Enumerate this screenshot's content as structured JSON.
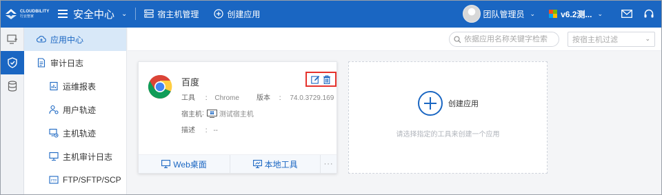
{
  "brand": {
    "logo_en": "CLOUDBILITY",
    "logo_cn": "行云管家"
  },
  "header": {
    "title": "安全中心",
    "nav": [
      {
        "label": "宿主机管理",
        "icon": "host-icon"
      },
      {
        "label": "创建应用",
        "icon": "plus-circle-icon"
      }
    ],
    "user": "团队管理员",
    "version": "v6.2测...",
    "icons": [
      "mail-icon",
      "headset-icon"
    ]
  },
  "rail": {
    "items": [
      {
        "icon": "console-icon",
        "active": false
      },
      {
        "icon": "shield-icon",
        "active": true
      },
      {
        "icon": "database-icon",
        "active": false
      }
    ]
  },
  "sidebar": {
    "items": [
      {
        "label": "应用中心",
        "icon": "cloud-app-icon",
        "level": 1,
        "active": true
      },
      {
        "label": "审计日志",
        "icon": "document-icon",
        "level": 1,
        "active": false
      },
      {
        "label": "运维报表",
        "icon": "report-icon",
        "level": 2,
        "active": false
      },
      {
        "label": "用户轨迹",
        "icon": "user-track-icon",
        "level": 2,
        "active": false
      },
      {
        "label": "主机轨迹",
        "icon": "host-track-icon",
        "level": 2,
        "active": false
      },
      {
        "label": "主机审计日志",
        "icon": "monitor-icon",
        "level": 2,
        "active": false
      },
      {
        "label": "FTP/SFTP/SCP",
        "icon": "ftp-icon",
        "level": 2,
        "active": false
      }
    ]
  },
  "toolbar": {
    "search_placeholder": "依据应用名称关键字检索",
    "host_filter_placeholder": "按宿主机过滤"
  },
  "app_card": {
    "name": "百度",
    "tool_label": "工具",
    "tool_value": "Chrome",
    "version_label": "版本",
    "version_value": "74.0.3729.169",
    "host_label": "宿主机",
    "host_value": "测试宿主机",
    "desc_label": "描述",
    "desc_value": "--",
    "sep": ":",
    "footer": {
      "web_desktop": "Web桌面",
      "local_tool": "本地工具",
      "more": "···"
    }
  },
  "create_card": {
    "label": "创建应用",
    "hint": "请选择指定的工具来创建一个应用"
  },
  "colors": {
    "primary": "#1a66c2",
    "highlight_box": "#e5322c",
    "active_bg": "#d8e8f8"
  }
}
